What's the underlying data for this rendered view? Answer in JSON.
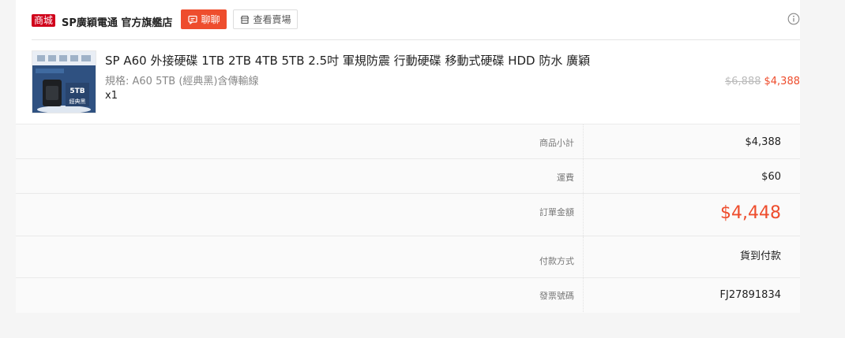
{
  "shop": {
    "badge": "商城",
    "name": "SP廣穎電通 官方旗艦店",
    "chat_label": "聊聊",
    "view_shop_label": "查看賣場"
  },
  "product": {
    "title": "SP A60 外接硬碟 1TB 2TB 4TB 5TB 2.5吋 軍規防震 行動硬碟 移動式硬碟 HDD 防水 廣穎",
    "variant": "規格: A60 5TB (經典黑)含傳輸線",
    "quantity": "x1",
    "price_original": "$6,888",
    "price_sale": "$4,388",
    "image_text_capacity": "5TB",
    "image_text_edition": "經典黑"
  },
  "summary": {
    "subtotal_label": "商品小計",
    "subtotal_value": "$4,388",
    "shipping_label": "運費",
    "shipping_value": "$60",
    "total_label": "訂單金額",
    "total_value": "$4,448",
    "payment_label": "付款方式",
    "payment_value": "貨到付款",
    "invoice_label": "發票號碼",
    "invoice_value": "FJ27891834"
  },
  "colors": {
    "accent": "#ee4d2d",
    "mall_badge": "#d0011b"
  }
}
